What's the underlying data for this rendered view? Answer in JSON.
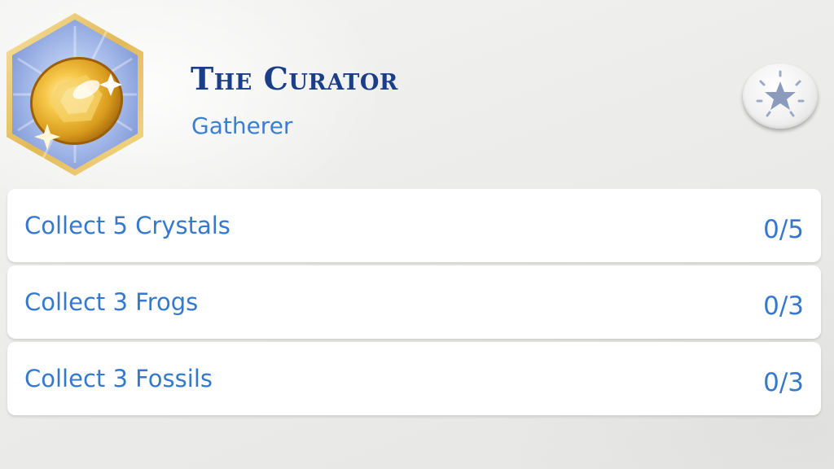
{
  "aspiration": {
    "title": "The Curator",
    "category": "Gatherer",
    "badge_icon": "golden-crystal-icon",
    "star_icon": "star-icon"
  },
  "goals": [
    {
      "label": "Collect 5 Crystals",
      "progress": "0/5",
      "current": 0,
      "target": 5
    },
    {
      "label": "Collect 3 Frogs",
      "progress": "0/3",
      "current": 0,
      "target": 3
    },
    {
      "label": "Collect 3 Fossils",
      "progress": "0/3",
      "current": 0,
      "target": 3
    }
  ],
  "colors": {
    "title": "#1b3f87",
    "text_accent": "#3579cf",
    "badge_frame": "#e9c46a",
    "badge_fill": "#8fa8e0",
    "gem": "#f2b83a",
    "star_button_star": "#8a9bbd"
  }
}
